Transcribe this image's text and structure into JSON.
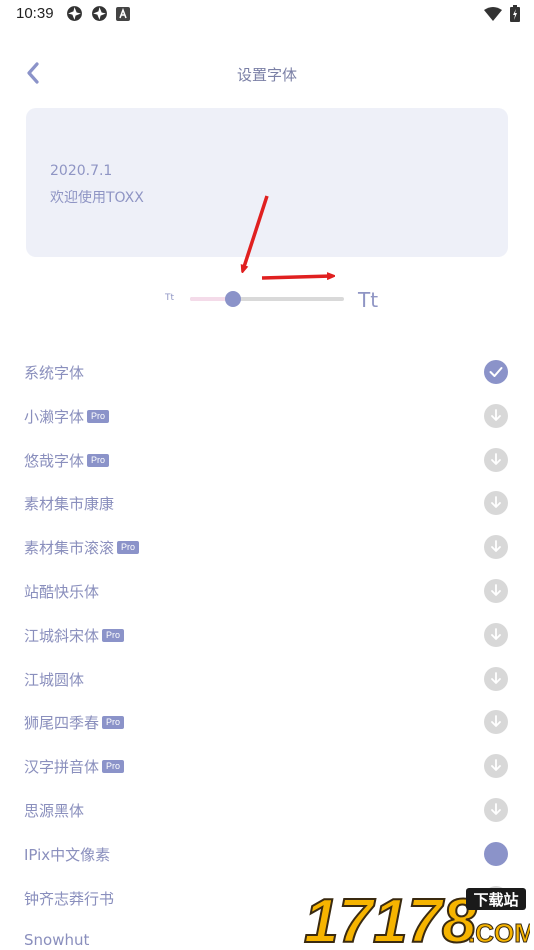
{
  "status_bar": {
    "time": "10:39",
    "left_icons": [
      "aperture-icon",
      "aperture-icon",
      "a-notification-icon"
    ],
    "right_icons": [
      "wifi-icon",
      "battery-charging-icon"
    ]
  },
  "header": {
    "title": "设置字体",
    "back_icon": "chevron-left-icon"
  },
  "preview": {
    "date": "2020.7.1",
    "text": "欢迎使用TOXX"
  },
  "font_size": {
    "small_label": "Tt",
    "large_label": "Tt",
    "level": 0.28
  },
  "fonts": [
    {
      "name": "系统字体",
      "pro": false,
      "status": "selected"
    },
    {
      "name": "小濑字体",
      "pro": true,
      "status": "download"
    },
    {
      "name": "悠哉字体",
      "pro": true,
      "status": "download"
    },
    {
      "name": "素材集市康康",
      "pro": false,
      "status": "download"
    },
    {
      "name": "素材集市滚滚",
      "pro": true,
      "status": "download"
    },
    {
      "name": "站酷快乐体",
      "pro": false,
      "status": "download"
    },
    {
      "name": "江城斜宋体",
      "pro": true,
      "status": "download"
    },
    {
      "name": "江城圆体",
      "pro": false,
      "status": "download"
    },
    {
      "name": "狮尾四季春",
      "pro": true,
      "status": "download"
    },
    {
      "name": "汉字拼音体",
      "pro": true,
      "status": "download"
    },
    {
      "name": "思源黑体",
      "pro": false,
      "status": "download"
    },
    {
      "name": "IPix中文像素",
      "pro": false,
      "status": "downloaded"
    },
    {
      "name": "钟齐志莽行书",
      "pro": false,
      "status": "download"
    },
    {
      "name": "Snowhut",
      "pro": false,
      "status": "none"
    }
  ],
  "pro_label": "Pro",
  "watermark": {
    "number": "17178",
    "tag": "下载站",
    "domain": ".COM"
  },
  "colors": {
    "accent": "#8b93c9",
    "text": "#8a8fbd",
    "card_bg": "#eef0f8",
    "download_bg": "#d8d8d8",
    "annotation_arrow": "#e02020"
  }
}
